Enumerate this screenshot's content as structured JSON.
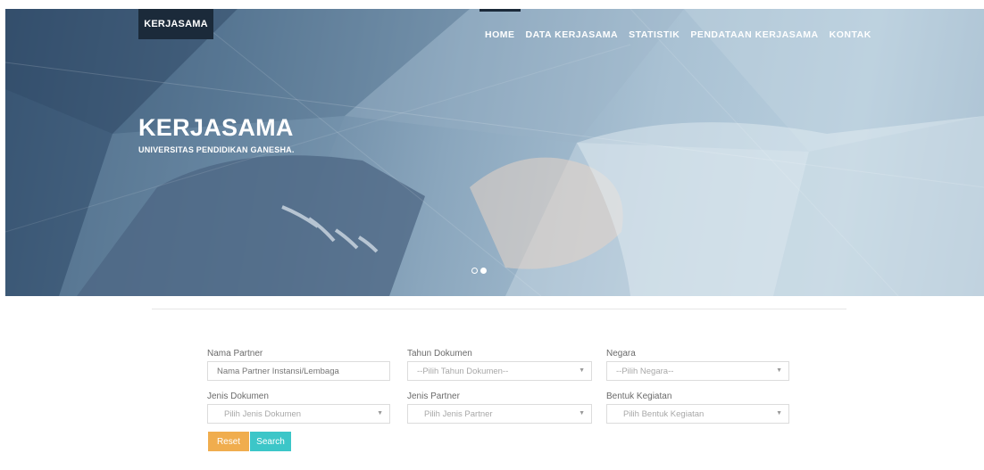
{
  "nav": {
    "brand": "KERJASAMA",
    "items": [
      {
        "label": "HOME",
        "active": true
      },
      {
        "label": "DATA KERJASAMA"
      },
      {
        "label": "STATISTIK"
      },
      {
        "label": "PENDATAAN KERJASAMA"
      },
      {
        "label": "KONTAK"
      }
    ]
  },
  "hero": {
    "title": "KERJASAMA",
    "subtitle": "UNIVERSITAS PENDIDIKAN GANESHA.",
    "slides": 2,
    "active_slide": 2
  },
  "form": {
    "nama_partner": {
      "label": "Nama Partner",
      "placeholder": "Nama Partner Instansi/Lembaga"
    },
    "tahun_dokumen": {
      "label": "Tahun Dokumen",
      "value": "--Pilih Tahun Dokumen--"
    },
    "negara": {
      "label": "Negara",
      "value": "--Pilih Negara--"
    },
    "jenis_dokumen": {
      "label": "Jenis Dokumen",
      "value": "Pilih Jenis Dokumen"
    },
    "jenis_partner": {
      "label": "Jenis Partner",
      "value": "Pilih Jenis Partner"
    },
    "bentuk_kegiatan": {
      "label": "Bentuk Kegiatan",
      "value": "Pilih Bentuk Kegiatan"
    },
    "reset_label": "Reset",
    "search_label": "Search"
  },
  "colors": {
    "nav_brand": "#1b2a3a",
    "reset": "#f0ad4e",
    "search": "#3cc6c8"
  },
  "icons": {
    "dropdown": "chevron-down-icon"
  }
}
